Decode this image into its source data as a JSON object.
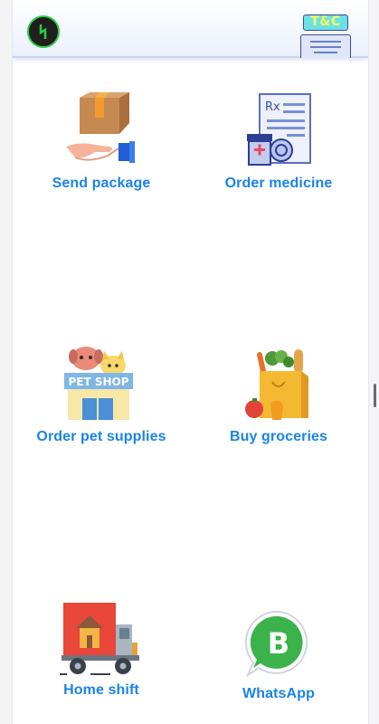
{
  "header": {
    "logo_icon": "lightning-bolt-icon",
    "tnc_label": "T&C"
  },
  "tiles": [
    {
      "label": "Send package",
      "icon": "package-hand-icon"
    },
    {
      "label": "Order medicine",
      "icon": "prescription-medicine-icon"
    },
    {
      "label": "Order pet supplies",
      "icon": "pet-shop-icon"
    },
    {
      "label": "Buy groceries",
      "icon": "grocery-bag-icon"
    },
    {
      "label": "Home shift",
      "icon": "moving-truck-icon"
    },
    {
      "label": "WhatsApp",
      "icon": "whatsapp-business-icon"
    }
  ],
  "illustration_text": {
    "pet_shop": "PET SHOP",
    "rx": "Rx",
    "whatsapp_letter": "B"
  },
  "colors": {
    "accent": "#1a84e8",
    "logo_ring": "#2ecc40"
  }
}
